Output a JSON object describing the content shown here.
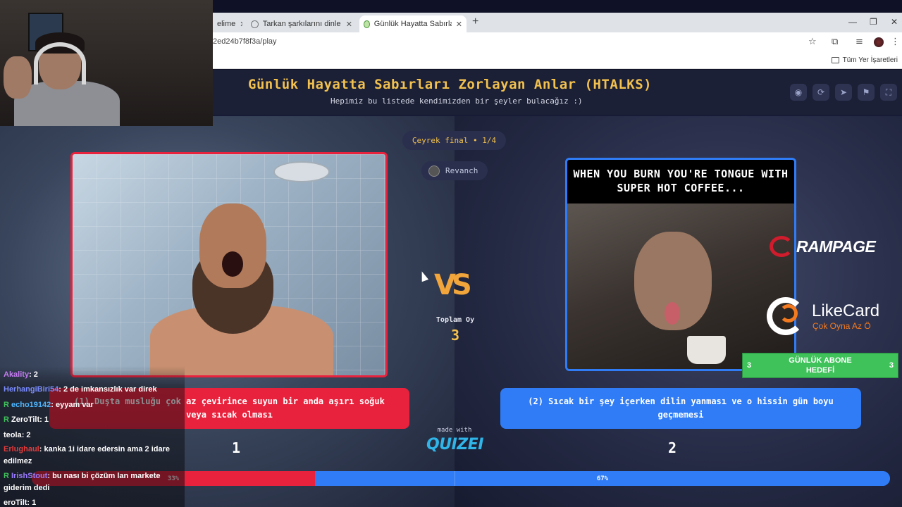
{
  "browser": {
    "tabs": [
      {
        "title": "elime",
        "active": false
      },
      {
        "title": "Tarkan şarkılarını dinle ve tahmi",
        "active": false
      },
      {
        "title": "Günlük Hayatta Sabırları Zorlay",
        "active": true
      }
    ],
    "new_tab": "+",
    "close": "✕",
    "url": "2ed24b7f8f3a/play",
    "bookmarks_label": "Tüm Yer İşaretleri"
  },
  "page": {
    "title": "Günlük Hayatta Sabırları Zorlayan Anlar (HTALKS)",
    "subtitle": "Hepimiz bu listede kendimizden bir şeyler bulacağız :)",
    "round": "Çeyrek final • 1/4",
    "revanch": "Revanch",
    "bg_text": "WHEN YOU BURN YOU'RE TONGUE\nWITH SUPER HOT COFFEE",
    "vs": "VS",
    "total_label": "Toplam Oy",
    "total_value": "3",
    "made_with": "made with",
    "brand": "QUIZEI"
  },
  "options": {
    "left": {
      "text": "(1) Duşta musluğu çok az çevirince suyun bir anda aşırı soğuk veya sıcak olması",
      "number": "1",
      "percent_label": "33%",
      "percent": 33,
      "color": "#e8213c"
    },
    "right": {
      "text": "(2) Sıcak bir şey içerken dilin yanması ve o hissin gün boyu geçmemesi",
      "number": "2",
      "percent_label": "67%",
      "percent": 67,
      "color": "#2f7cf6",
      "meme_caption": "WHEN YOU BURN YOU'RE TONGUE WITH SUPER HOT COFFEE..."
    }
  },
  "chat": [
    {
      "user": "Akality",
      "msg": ": 2",
      "color": "#c57cf2"
    },
    {
      "user": "HerhangiBiri54",
      "msg": ": 2 de imkansızlık var direk",
      "color": "#7a8cff"
    },
    {
      "user": "echo19142",
      "msg": ": eyyam var",
      "color": "#4fb6ff",
      "badge": "R"
    },
    {
      "user": "ZeroTilt",
      "msg": ": 1",
      "color": "#ffffff",
      "badge": "R"
    },
    {
      "user": "teola",
      "msg": ": 2",
      "color": "#ffffff"
    },
    {
      "user": "Erlughaul",
      "msg": ": kanka 1i idare edersin ama 2 idare edilmez",
      "color": "#e23b3b"
    },
    {
      "user": "IrishStout",
      "msg": ": bu nası bi çözüm lan markete giderim dedi",
      "color": "#9b7cff",
      "badge": "R"
    },
    {
      "user": "eroTilt",
      "msg": ": 1",
      "color": "#ffffff"
    }
  ],
  "overlays": {
    "rampage": "RAMPAGE",
    "likecard": "LikeCard",
    "likecard_sub": "Çok Oyna  Az Ö",
    "goal_title": "GÜNLÜK ABONE HEDEFİ",
    "goal_left": "3",
    "goal_right": "3"
  }
}
